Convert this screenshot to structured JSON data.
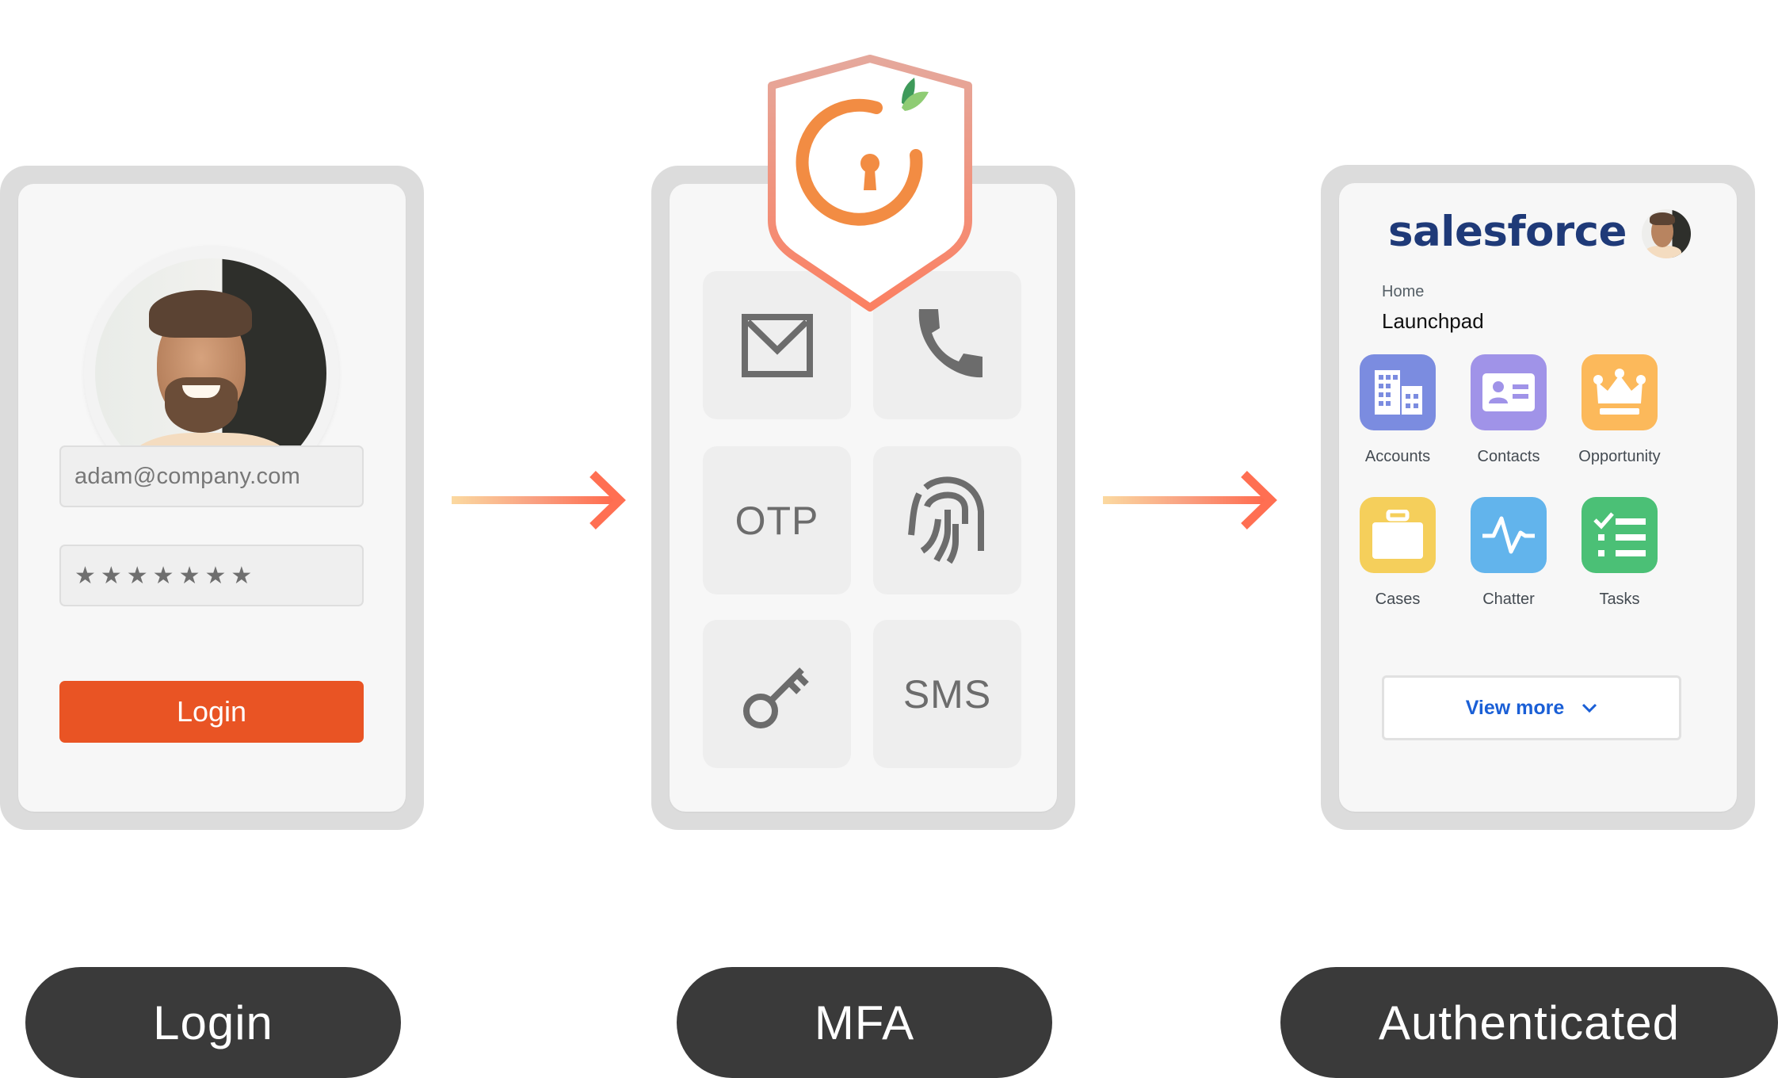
{
  "login_step": {
    "email_value": "adam@company.com",
    "password_mask": "★★★★★★★",
    "login_button_label": "Login"
  },
  "mfa_step": {
    "logo": "keyhole-shield-logo",
    "methods": [
      {
        "name": "email",
        "icon": "envelope-icon"
      },
      {
        "name": "phone",
        "icon": "phone-icon"
      },
      {
        "name": "otp",
        "label": "OTP"
      },
      {
        "name": "fingerprint",
        "icon": "fingerprint-icon"
      },
      {
        "name": "security-key",
        "icon": "key-icon"
      },
      {
        "name": "sms",
        "label": "SMS"
      }
    ]
  },
  "authenticated_step": {
    "brand": "salesforce",
    "breadcrumb": "Home",
    "page_title": "Launchpad",
    "apps": [
      {
        "label": "Accounts",
        "color": "#7b8ce0",
        "icon": "building-icon"
      },
      {
        "label": "Contacts",
        "color": "#a093e8",
        "icon": "contact-card-icon"
      },
      {
        "label": "Opportunity",
        "color": "#fcb95b",
        "icon": "crown-icon"
      },
      {
        "label": "Cases",
        "color": "#f5cf5b",
        "icon": "briefcase-icon"
      },
      {
        "label": "Chatter",
        "color": "#62b4ec",
        "icon": "pulse-icon"
      },
      {
        "label": "Tasks",
        "color": "#4bc076",
        "icon": "checklist-icon"
      }
    ],
    "view_more_label": "View more"
  },
  "steps": [
    {
      "label": "Login"
    },
    {
      "label": "MFA"
    },
    {
      "label": "Authenticated"
    }
  ],
  "colors": {
    "accent_orange": "#e95424",
    "pill_bg": "#3a3a3a",
    "link_blue": "#1a5fd6",
    "brand_navy": "#1f3a78"
  }
}
